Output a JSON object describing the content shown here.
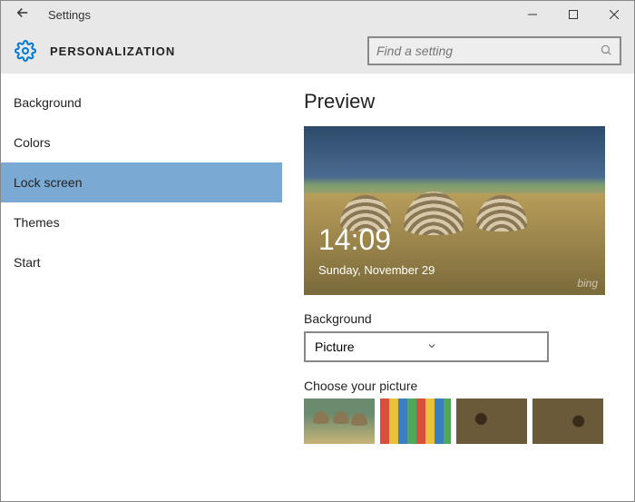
{
  "titlebar": {
    "title": "Settings"
  },
  "header": {
    "category": "PERSONALIZATION"
  },
  "search": {
    "placeholder": "Find a setting"
  },
  "sidebar": {
    "items": [
      {
        "label": "Background"
      },
      {
        "label": "Colors"
      },
      {
        "label": "Lock screen"
      },
      {
        "label": "Themes"
      },
      {
        "label": "Start"
      }
    ],
    "selectedIndex": 2
  },
  "main": {
    "preview_heading": "Preview",
    "lock_time": "14:09",
    "lock_date": "Sunday, November 29",
    "watermark": "bing",
    "background_label": "Background",
    "background_value": "Picture",
    "choose_label": "Choose your picture"
  }
}
